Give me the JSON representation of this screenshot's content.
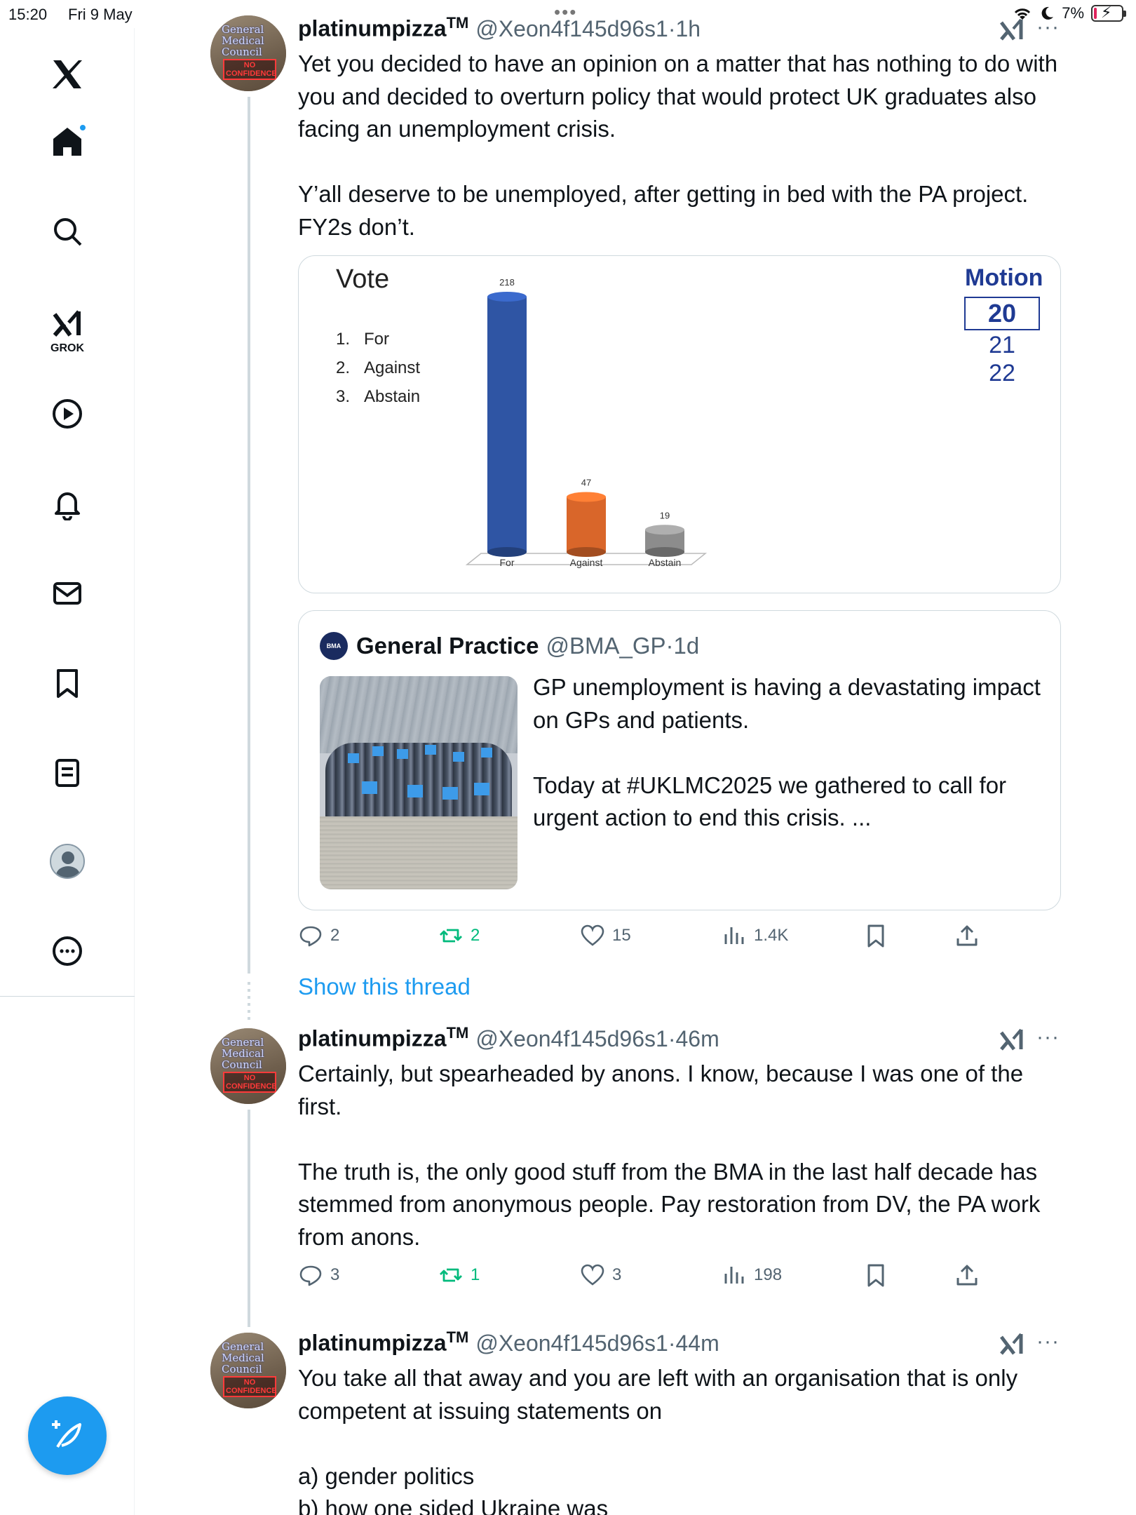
{
  "status_bar": {
    "time": "15:20",
    "date": "Fri 9 May",
    "battery": "7%",
    "battery_level": 0.07
  },
  "sidebar": {
    "items": [
      {
        "name": "x-logo-icon"
      },
      {
        "name": "home-icon",
        "has_notification": true
      },
      {
        "name": "search-icon"
      },
      {
        "name": "grok-icon",
        "label": "GROK"
      },
      {
        "name": "video-icon"
      },
      {
        "name": "notifications-icon"
      },
      {
        "name": "messages-icon"
      },
      {
        "name": "bookmarks-icon"
      },
      {
        "name": "lists-icon"
      },
      {
        "name": "profile-icon"
      },
      {
        "name": "more-icon"
      }
    ],
    "compose_icon": "compose-feather-icon"
  },
  "tweets": [
    {
      "display_name": "platinumpizza",
      "tm": "TM",
      "handle": "@Xeon4f145d96s1",
      "time": "·1h",
      "avatar_text": "General Medical Council",
      "avatar_stamp": "NO CONFIDENCE",
      "text": "Yet you decided to have an opinion on a matter that has nothing to do with you and decided to overturn policy that would protect UK graduates also facing an unemployment crisis.\n\nY’all deserve to be unemployed, after getting in bed with the PA project. FY2s don’t.",
      "actions": {
        "replies": "2",
        "reposts": "2",
        "likes": "15",
        "views": "1.4K"
      }
    },
    {
      "display_name": "platinumpizza",
      "tm": "TM",
      "handle": "@Xeon4f145d96s1",
      "time": "·46m",
      "avatar_text": "General Medical Council",
      "avatar_stamp": "NO CONFIDENCE",
      "text": "Certainly, but spearheaded by anons. I know, because I was one of the first.\n\nThe truth is, the only good stuff from the BMA in the last half decade has stemmed from anonymous people. Pay restoration from DV, the PA work from anons.",
      "actions": {
        "replies": "3",
        "reposts": "1",
        "likes": "3",
        "views": "198"
      }
    },
    {
      "display_name": "platinumpizza",
      "tm": "TM",
      "handle": "@Xeon4f145d96s1",
      "time": "·44m",
      "avatar_text": "General Medical Council",
      "avatar_stamp": "NO CONFIDENCE",
      "text": "You take all that away and you are left with an organisation that is only competent at issuing statements on\n\na) gender politics\nb) how one sided Ukraine was"
    }
  ],
  "show_thread": "Show this thread",
  "vote_card": {
    "title": "Vote",
    "options": [
      {
        "num": "1.",
        "label": "For"
      },
      {
        "num": "2.",
        "label": "Against"
      },
      {
        "num": "3.",
        "label": "Abstain"
      }
    ],
    "motion_title": "Motion",
    "motion_current": "20",
    "motion_next": [
      "21",
      "22"
    ]
  },
  "chart_data": {
    "type": "bar",
    "title": "Vote",
    "categories": [
      "For",
      "Against",
      "Abstain"
    ],
    "values": [
      218,
      47,
      19
    ],
    "colors": [
      "#2f55a4",
      "#d9662a",
      "#8c8c8c"
    ],
    "xlabel": "",
    "ylabel": "",
    "ylim": [
      0,
      218
    ],
    "grid": false
  },
  "quote": {
    "logo_text": "BMA",
    "name": "General Practice",
    "handle": "@BMA_GP",
    "time": "·1d",
    "text": "GP unemployment is having a devastating impact on GPs and patients.\n\nToday at #UKLMC2025 we gathered to call for urgent action to end this crisis. ..."
  },
  "colors": {
    "accent": "#1d9bf0",
    "repost_green": "#00ba7c",
    "secondary_text": "#536471",
    "motion_blue": "#1f3a93"
  }
}
